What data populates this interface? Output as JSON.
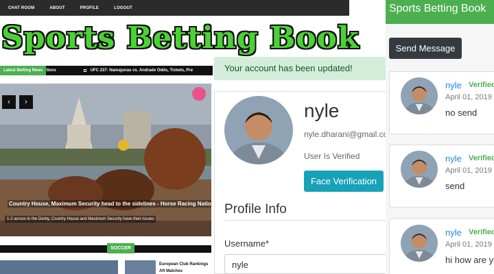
{
  "nav": {
    "items": [
      "CHAT ROOM",
      "ABOUT",
      "PROFILE",
      "LOGOUT"
    ]
  },
  "site": {
    "logo": "Sports Betting Book"
  },
  "ticker": {
    "label": "Latest Betting News",
    "item1": "tions",
    "item2": "UFC 237: Namajunas vs. Andrade Odds, Tickets, Pre"
  },
  "hero": {
    "title": "Country House, Maximum Security head to the sidelines - Horse Racing Nation",
    "subtitle": "1-2 across in the Derby, Country House and Maximum Security have their issues",
    "prev_icon": "chevron-left-icon",
    "next_icon": "chevron-right-icon"
  },
  "section": {
    "label": "SOCCER"
  },
  "article": {
    "title": "European Club Rankings Aft Matches"
  },
  "alert": {
    "text": "Your account has been updated!"
  },
  "profile": {
    "username": "nyle",
    "email": "nyle.dharani@gmail.com",
    "status": "User Is Verified",
    "face_button": "Face Verification",
    "section_title": "Profile Info",
    "username_label": "Username*",
    "username_value": "nyle"
  },
  "chat": {
    "title": "Sports Betting Book",
    "send_button": "Send Message",
    "messages": [
      {
        "user": "nyle",
        "badge": "Verified",
        "date": "April 01, 2019",
        "text": "no send"
      },
      {
        "user": "nyle",
        "badge": "Verified",
        "date": "April 01, 2019",
        "text": "send"
      },
      {
        "user": "nyle",
        "badge": "Verified",
        "date": "April 01, 2019",
        "text": "hi how are yo"
      }
    ]
  },
  "colors": {
    "accent": "#4caf50",
    "info": "#17a2b8",
    "alert_bg": "#d4edda",
    "dark": "#343a40"
  }
}
